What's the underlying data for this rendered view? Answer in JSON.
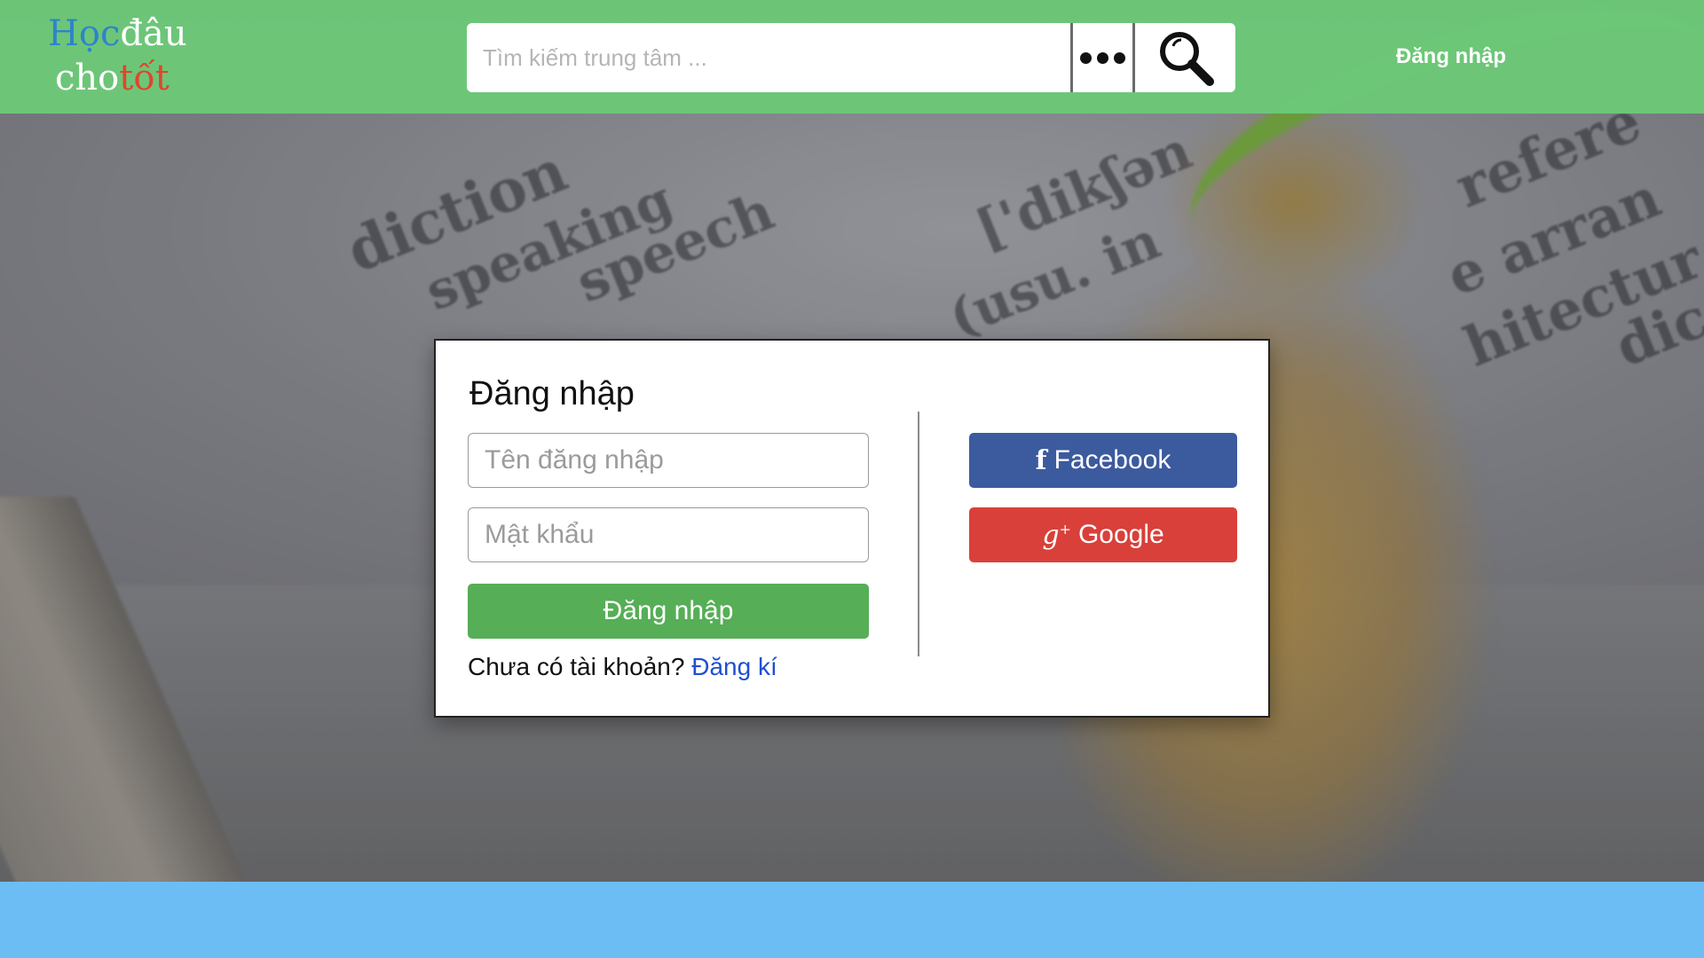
{
  "header": {
    "logo": {
      "part1": "Học",
      "part2": "đâu",
      "part3": "cho",
      "part4": "tốt"
    },
    "search": {
      "placeholder": "Tìm kiếm trung tâm ..."
    },
    "login_link": "Đăng nhập"
  },
  "login": {
    "title": "Đăng nhập",
    "username_placeholder": "Tên đăng nhập",
    "password_placeholder": "Mật khẩu",
    "submit_label": "Đăng nhập",
    "no_account_text": "Chưa có tài khoản?",
    "signup_link": "Đăng kí",
    "facebook_label": "Facebook",
    "google_label": "Google"
  },
  "colors": {
    "header_bg": "#6cc878",
    "logo_blue": "#2e84c9",
    "logo_red": "#e0452d",
    "submit_green": "#56ae56",
    "facebook_blue": "#3c5a9e",
    "google_red": "#d9403a",
    "link_blue": "#1f4fd1",
    "footer_bg": "#6cbdf4"
  },
  "icons": [
    "more-dots-icon",
    "search-icon",
    "facebook-icon",
    "google-plus-icon"
  ]
}
